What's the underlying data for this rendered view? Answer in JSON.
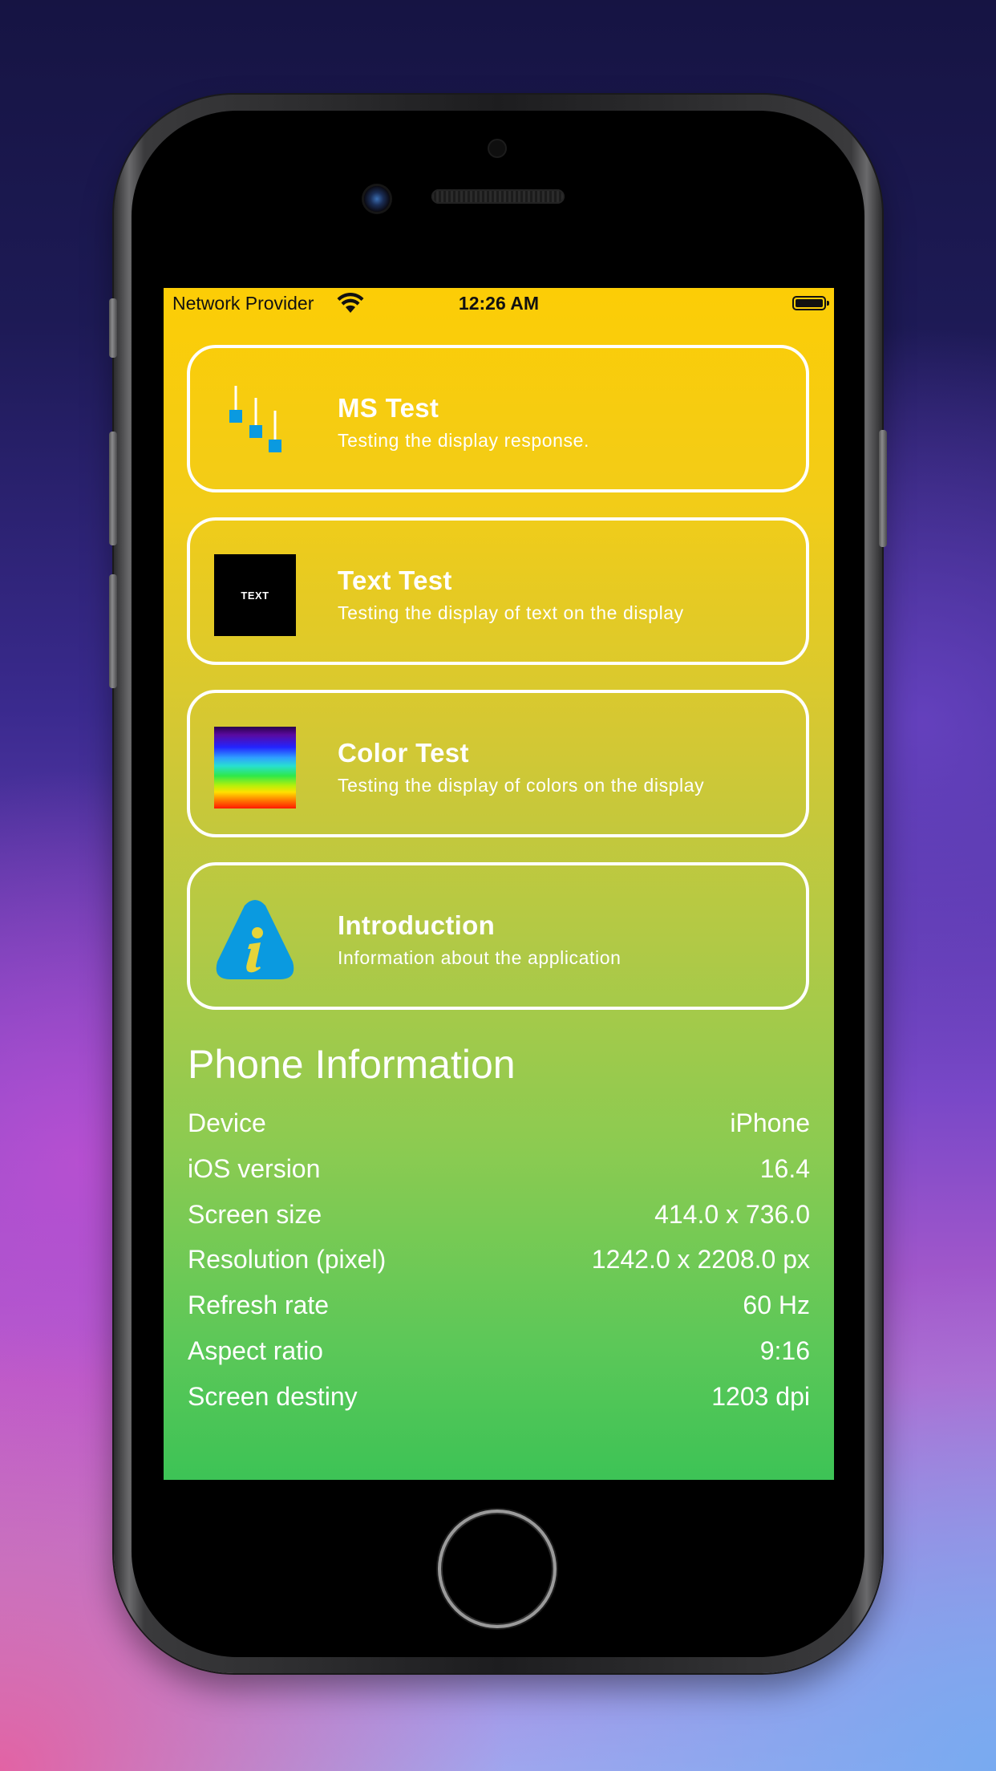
{
  "status_bar": {
    "carrier": "Network Provider",
    "time": "12:26 AM"
  },
  "menu": [
    {
      "title": "MS Test",
      "description": "Testing the display response.",
      "icon": "sliders-icon"
    },
    {
      "title": "Text Test",
      "description": "Testing the display of text on the display",
      "icon": "text-icon",
      "icon_text": "TEXT"
    },
    {
      "title": "Color Test",
      "description": "Testing the display of colors on the display",
      "icon": "color-spectrum-icon"
    },
    {
      "title": "Introduction",
      "description": "Information about the application",
      "icon": "info-warning-icon"
    }
  ],
  "phone_info": {
    "title": "Phone Information",
    "rows": [
      {
        "label": "Device",
        "value": "iPhone"
      },
      {
        "label": "iOS version",
        "value": "16.4"
      },
      {
        "label": "Screen size",
        "value": "414.0 x 736.0"
      },
      {
        "label": "Resolution (pixel)",
        "value": "1242.0 x 2208.0 px"
      },
      {
        "label": "Refresh rate",
        "value": "60 Hz"
      },
      {
        "label": "Aspect ratio",
        "value": "9:16"
      },
      {
        "label": "Screen destiny",
        "value": "1203 dpi"
      }
    ]
  },
  "colors": {
    "accent_blue": "#0a9ae0",
    "card_border": "#ffffff",
    "gradient_top": "#fccd06",
    "gradient_bottom": "#3dc356"
  }
}
